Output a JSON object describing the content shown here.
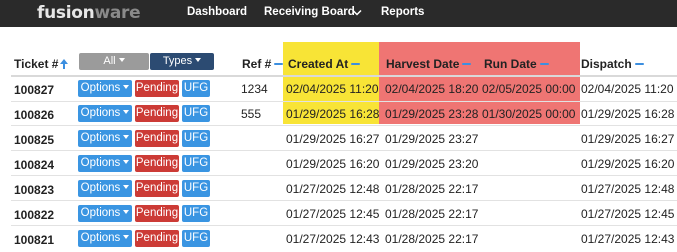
{
  "nav": {
    "brand_part1": "fusion",
    "brand_part2": "ware",
    "dashboard": "Dashboard",
    "receiving_board": "Receiving Board",
    "reports": "Reports"
  },
  "table": {
    "headers": {
      "ticket": "Ticket #",
      "all_filter": "All",
      "types_filter": "Types",
      "ref": "Ref #",
      "created_at": "Created At",
      "harvest_date": "Harvest Date",
      "run_date": "Run Date",
      "dispatch": "Dispatch"
    },
    "highlight_colors": {
      "created_at": "#f8e436",
      "harvest_run": "#ef7573"
    },
    "rows": [
      {
        "ticket": "100827",
        "options": "Options",
        "status": "Pending",
        "type": "UFG",
        "ref": "1234",
        "created": "02/04/2025 11:20",
        "harvest": "02/04/2025 18:20",
        "run": "02/05/2025 00:00",
        "dispatch": "02/04/2025 11:20"
      },
      {
        "ticket": "100826",
        "options": "Options",
        "status": "Pending",
        "type": "UFG",
        "ref": "555",
        "created": "01/29/2025 16:28",
        "harvest": "01/29/2025 23:28",
        "run": "01/30/2025 00:00",
        "dispatch": "01/29/2025 16:28"
      },
      {
        "ticket": "100825",
        "options": "Options",
        "status": "Pending",
        "type": "UFG",
        "ref": "",
        "created": "01/29/2025 16:27",
        "harvest": "01/29/2025 23:27",
        "run": "",
        "dispatch": "01/29/2025 16:27"
      },
      {
        "ticket": "100824",
        "options": "Options",
        "status": "Pending",
        "type": "UFG",
        "ref": "",
        "created": "01/29/2025 16:20",
        "harvest": "01/29/2025 23:20",
        "run": "",
        "dispatch": "01/29/2025 16:20"
      },
      {
        "ticket": "100823",
        "options": "Options",
        "status": "Pending",
        "type": "UFG",
        "ref": "",
        "created": "01/27/2025 12:48",
        "harvest": "01/28/2025 22:17",
        "run": "",
        "dispatch": "01/27/2025 12:48"
      },
      {
        "ticket": "100822",
        "options": "Options",
        "status": "Pending",
        "type": "UFG",
        "ref": "",
        "created": "01/27/2025 12:45",
        "harvest": "01/28/2025 22:17",
        "run": "",
        "dispatch": "01/27/2025 12:45"
      },
      {
        "ticket": "100821",
        "options": "Options",
        "status": "Pending",
        "type": "UFG",
        "ref": "",
        "created": "01/27/2025 12:43",
        "harvest": "01/28/2025 22:17",
        "run": "",
        "dispatch": "01/27/2025 12:43"
      }
    ]
  }
}
